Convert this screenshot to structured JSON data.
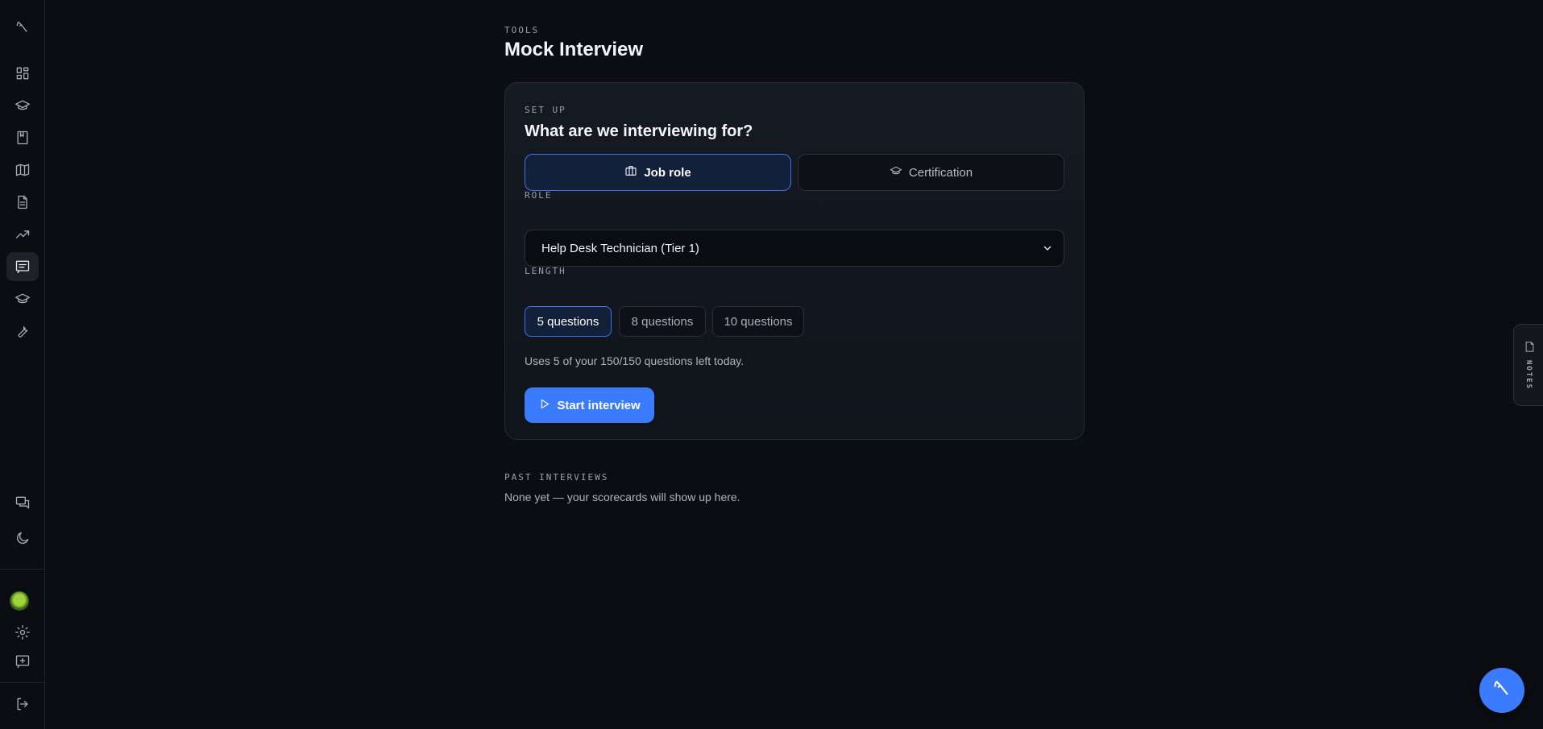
{
  "sidebar": {
    "items": [
      {
        "name": "dashboard-icon"
      },
      {
        "name": "graduation-cap-icon"
      },
      {
        "name": "book-icon"
      },
      {
        "name": "map-icon"
      },
      {
        "name": "document-icon"
      },
      {
        "name": "trending-up-icon"
      },
      {
        "name": "chat-list-icon",
        "active": true
      },
      {
        "name": "graduation-cap-icon"
      },
      {
        "name": "wrench-icon"
      }
    ],
    "bottom": [
      {
        "name": "messages-icon"
      },
      {
        "name": "moon-icon"
      },
      {
        "name": "avatar"
      },
      {
        "name": "gear-icon"
      },
      {
        "name": "feedback-icon"
      },
      {
        "name": "logout-icon"
      }
    ]
  },
  "page": {
    "eyebrow": "TOOLS",
    "title": "Mock Interview"
  },
  "setup": {
    "eyebrow": "SET UP",
    "title": "What are we interviewing for?",
    "modes": [
      {
        "label": "Job role",
        "icon": "briefcase-icon",
        "selected": true
      },
      {
        "label": "Certification",
        "icon": "graduation-cap-icon",
        "selected": false
      }
    ],
    "role_label": "ROLE",
    "role_value": "Help Desk Technician (Tier 1)",
    "length_label": "LENGTH",
    "lengths": [
      {
        "label": "5 questions",
        "selected": true
      },
      {
        "label": "8 questions",
        "selected": false
      },
      {
        "label": "10 questions",
        "selected": false
      }
    ],
    "usage": "Uses 5 of your 150/150 questions left today.",
    "start_label": "Start interview"
  },
  "past": {
    "eyebrow": "PAST INTERVIEWS",
    "empty": "None yet — your scorecards will show up here."
  },
  "notes_tab": {
    "label": "NOTES"
  },
  "colors": {
    "accent": "#3b7bff",
    "background": "#0b0d12"
  }
}
